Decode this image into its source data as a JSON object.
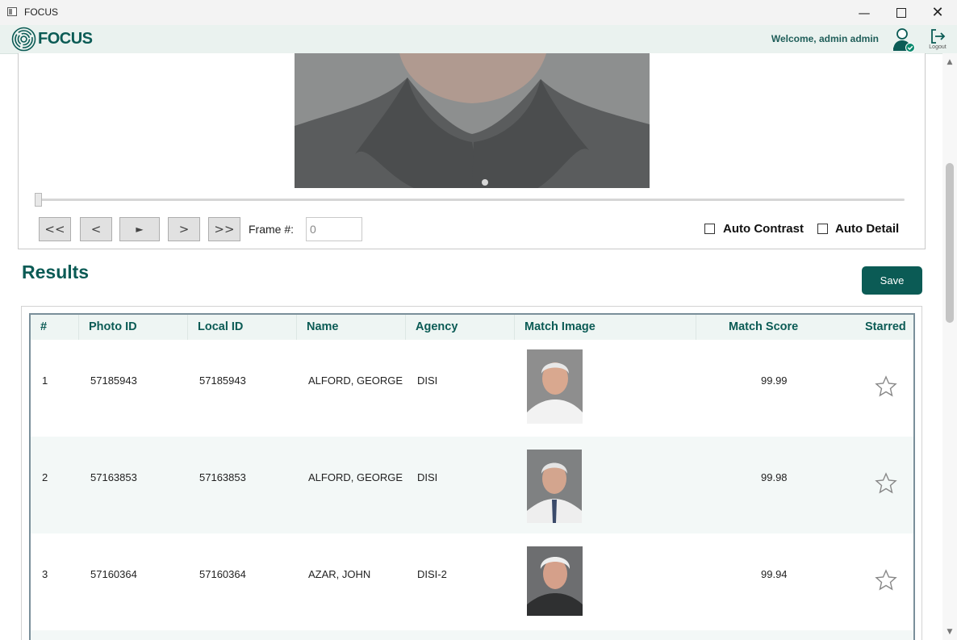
{
  "window": {
    "title": "FOCUS"
  },
  "header": {
    "logo_text": "FOCUS",
    "welcome": "Welcome, admin admin",
    "logout_label": "Logout"
  },
  "player": {
    "buttons": {
      "first": "<<",
      "prev": "<",
      "play": "►",
      "next": ">",
      "last": ">>"
    },
    "frame_label": "Frame #:",
    "frame_value": "0",
    "auto_contrast": "Auto Contrast",
    "auto_detail": "Auto Detail",
    "auto_contrast_checked": false,
    "auto_detail_checked": false,
    "slider_position": 0
  },
  "results": {
    "title": "Results",
    "save_label": "Save",
    "columns": [
      "#",
      "Photo ID",
      "Local ID",
      "Name",
      "Agency",
      "Match Image",
      "Match Score",
      "Starred"
    ],
    "rows": [
      {
        "num": "1",
        "photo_id": "57185943",
        "local_id": "57185943",
        "name": "ALFORD, GEORGE",
        "agency": "DISI",
        "score": "99.99",
        "starred": false
      },
      {
        "num": "2",
        "photo_id": "57163853",
        "local_id": "57163853",
        "name": "ALFORD, GEORGE",
        "agency": "DISI",
        "score": "99.98",
        "starred": false
      },
      {
        "num": "3",
        "photo_id": "57160364",
        "local_id": "57160364",
        "name": "AZAR, JOHN",
        "agency": "DISI-2",
        "score": "99.94",
        "starred": false
      }
    ]
  },
  "colors": {
    "brand": "#0b5b55",
    "header_bg": "#eaf2ef",
    "row_alt_bg": "#f3f8f7"
  }
}
